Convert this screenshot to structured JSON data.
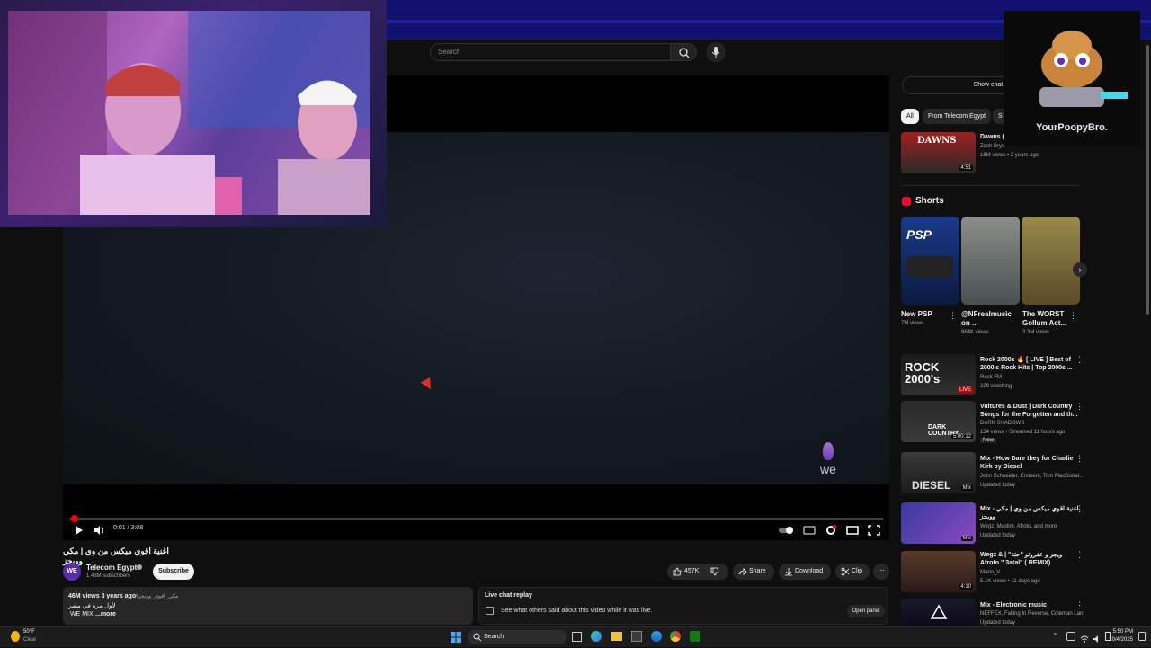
{
  "search": {
    "placeholder": "Search"
  },
  "player": {
    "time": "0:01 / 3:08",
    "progress_fraction": 0.005,
    "watermark": "we"
  },
  "video": {
    "title": "اغنية اقوي ميكس من وي | مكي وويجز",
    "channel": "Telecom Egypt",
    "channel_avatar": "WE",
    "subscribers": "1.43M subscribers",
    "subscribe_label": "Subscribe",
    "likes": "457K",
    "share_label": "Share",
    "download_label": "Download",
    "clip_label": "Clip"
  },
  "description": {
    "views_date": "46M views  3 years ago",
    "tags": "#مكي_اقوي_وويجز",
    "line1": "لأول مرة في مصر",
    "line2": "WE MIX",
    "more": "...more"
  },
  "live_chat": {
    "title": "Live chat replay",
    "text": "See what others said about this video while it was live.",
    "button": "Open panel"
  },
  "sidebar": {
    "show_chat": "Show chat re",
    "chips": [
      "All",
      "From Telecom Egypt",
      "S"
    ],
    "top_item": {
      "title": "Dawns (",
      "channel": "Zach Bryc",
      "meta": "18M views • 2 years ago",
      "duration": "4:51",
      "thumb_text": "DAWNS"
    },
    "shorts_heading": "Shorts",
    "shorts": [
      {
        "title": "New PSP",
        "views": "7M views",
        "thumb_text": "PSP"
      },
      {
        "title": "@NFrealmusic on ...",
        "views": "864K views"
      },
      {
        "title": "The WORST Gollum Act...",
        "views": "3.3M views"
      }
    ],
    "items": [
      {
        "title": "Rock 2000s 🔥 [ LIVE ] Best of 2000's Rock Hits | Top 2000s ...",
        "channel": "Rock FM",
        "meta": "229 watching",
        "badge": "LIVE",
        "thumb_text": "ROCK 2000's"
      },
      {
        "title": "Vultures & Dust | Dark Country Songs for the Forgotten and th...",
        "channel": "DARK SHADOWS",
        "meta": "134 views • Streamed 11 hours ago",
        "badge": "New",
        "duration": "5:00:12",
        "thumb_text": "DARK COUNTRY"
      },
      {
        "title": "Mix - How Dare they for Charlie Kirk by Diesel",
        "channel": "John Schneider, Eminem, Tom MacDonal...",
        "meta": "Updated today",
        "duration": "Mix",
        "thumb_text": "DIESEL"
      },
      {
        "title": "Mix - اغنية اقوي ميكس من وي | مكي وويجز",
        "channel": "Wegz, Muslim, Afroto, and more",
        "meta": "Updated today",
        "duration": "Mix"
      },
      {
        "title": "Wegz & | \"ويجز و عفروتو \"حتة Afroto \" 3atal\" ( REMIX)",
        "channel": "Mario_V",
        "meta": "5.1K views • 11 days ago",
        "duration": "4:10"
      },
      {
        "title": "Mix - Electronic music",
        "channel": "NEFFEX, Falling In Reverse, Coleman Lan...",
        "meta": "Updated today"
      }
    ]
  },
  "overlay": {
    "brand": "YourPoopyBro."
  },
  "taskbar": {
    "weather_temp": "50°F",
    "weather_desc": "Clear",
    "search": "Search",
    "time": "5:50 PM",
    "date": "10/4/2025"
  }
}
